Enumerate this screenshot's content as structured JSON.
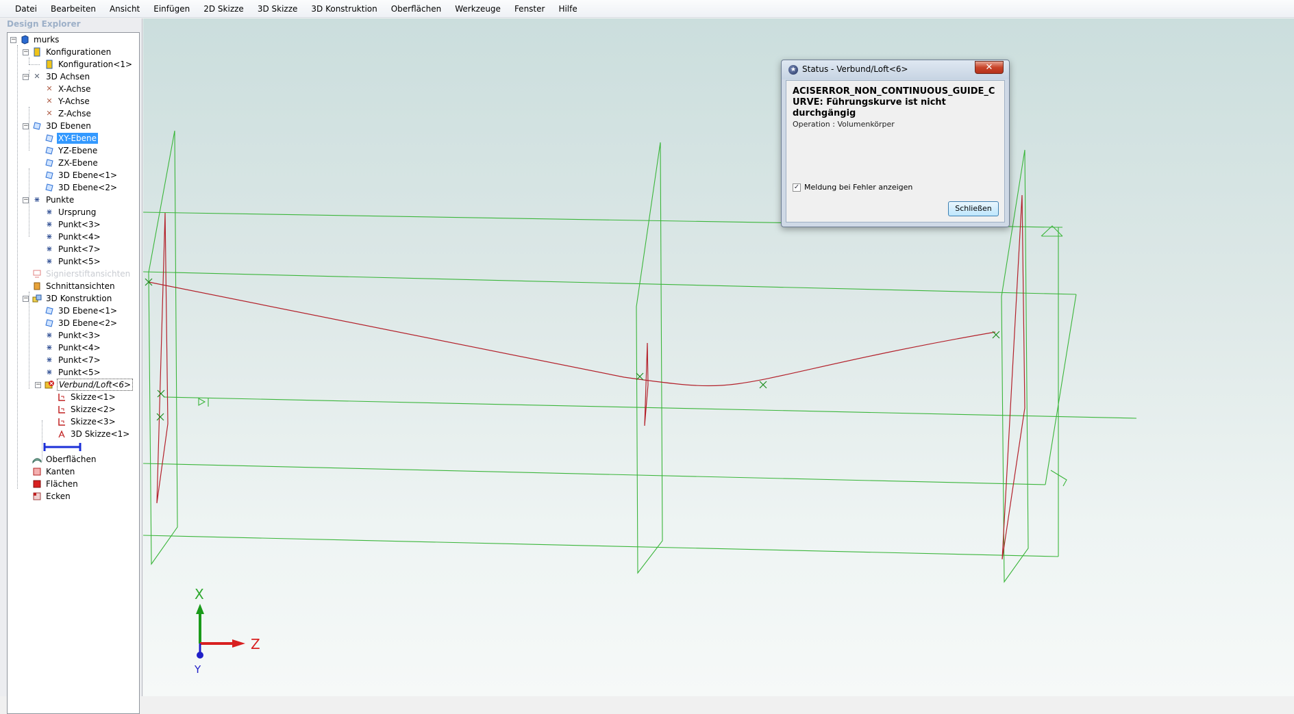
{
  "menubar": {
    "items": [
      "Datei",
      "Bearbeiten",
      "Ansicht",
      "Einfügen",
      "2D Skizze",
      "3D Skizze",
      "3D Konstruktion",
      "Oberflächen",
      "Werkzeuge",
      "Fenster",
      "Hilfe"
    ]
  },
  "explorer": {
    "title": "Design Explorer",
    "root": "murks",
    "konfigurationen": "Konfigurationen",
    "konfiguration1": "Konfiguration<1>",
    "achsen": "3D Achsen",
    "x_achse": "X-Achse",
    "y_achse": "Y-Achse",
    "z_achse": "Z-Achse",
    "ebenen": "3D Ebenen",
    "xy_ebene": "XY-Ebene",
    "yz_ebene": "YZ-Ebene",
    "zx_ebene": "ZX-Ebene",
    "ebene1": "3D Ebene<1>",
    "ebene2": "3D Ebene<2>",
    "punkte": "Punkte",
    "ursprung": "Ursprung",
    "punkt3": "Punkt<3>",
    "punkt4": "Punkt<4>",
    "punkt7": "Punkt<7>",
    "punkt5": "Punkt<5>",
    "signierstift": "Signierstiftansichten",
    "schnittansichten": "Schnittansichten",
    "konstruktion": "3D Konstruktion",
    "k_ebene1": "3D Ebene<1>",
    "k_ebene2": "3D Ebene<2>",
    "k_punkt3": "Punkt<3>",
    "k_punkt4": "Punkt<4>",
    "k_punkt7": "Punkt<7>",
    "k_punkt5": "Punkt<5>",
    "loft": "Verbund/Loft<6>",
    "skizze1": "Skizze<1>",
    "skizze2": "Skizze<2>",
    "skizze3": "Skizze<3>",
    "skizze3d": "3D Skizze<1>",
    "oberflaechen": "Oberflächen",
    "kanten": "Kanten",
    "flaechen": "Flächen",
    "ecken": "Ecken"
  },
  "dialog": {
    "title": "Status  - Verbund/Loft<6>",
    "close": "✕",
    "message": "ACISERROR_NON_CONTINUOUS_GUIDE_CURVE: Führungskurve ist nicht durchgängig",
    "operation": "Operation : Volumenkörper",
    "checkbox_checked": true,
    "checkbox_label": "Meldung bei Fehler anzeigen",
    "button": "Schließen"
  },
  "triad": {
    "y_label": "X",
    "z_label": "Z",
    "x_label": "Y"
  },
  "colors": {
    "construction": "#3ab53a",
    "curve": "#b3202a",
    "selection": "#3399ff"
  }
}
